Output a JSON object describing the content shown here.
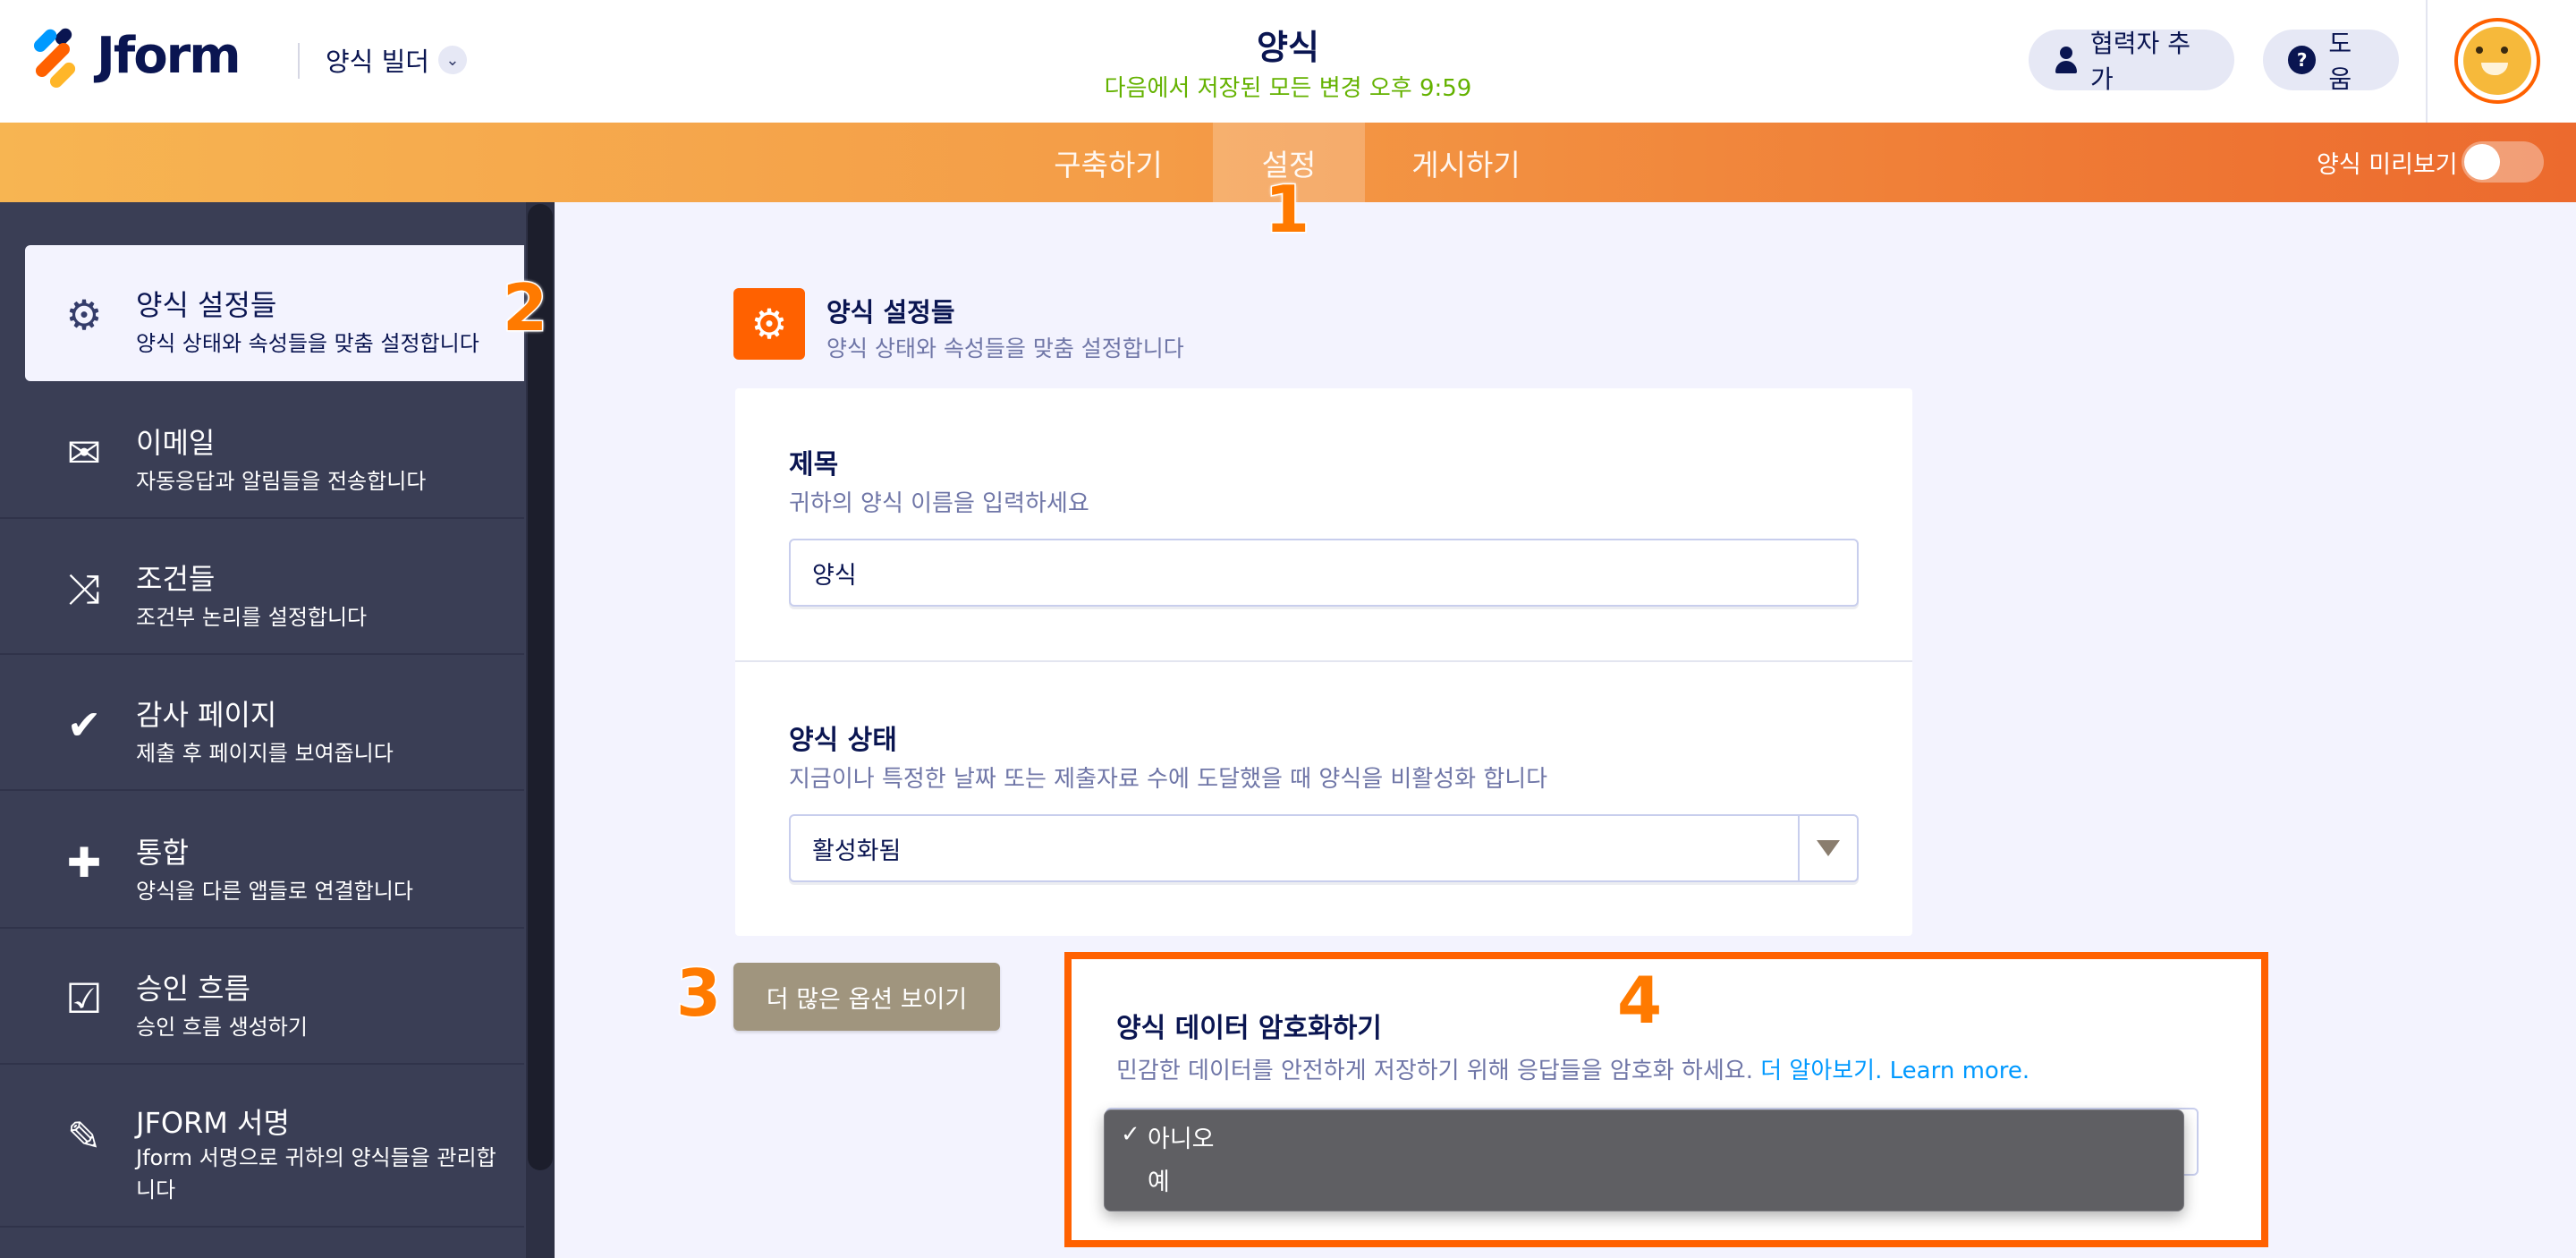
{
  "header": {
    "logo_text": "Jform",
    "builder_label": "양식 빌더",
    "form_title": "양식",
    "save_status": "다음에서 저장된 모든 변경 오후 9:59",
    "add_collaborator_label": "협력자 추가",
    "help_label": "도움"
  },
  "navbar": {
    "tabs": [
      {
        "label": "구축하기"
      },
      {
        "label": "설정"
      },
      {
        "label": "게시하기"
      }
    ],
    "preview_label": "양식 미리보기",
    "preview_enabled": false
  },
  "sidebar": {
    "items": [
      {
        "title": "양식 설정들",
        "desc": "양식 상태와 속성들을 맞춤 설정합니다",
        "icon": "gear-icon",
        "active": true
      },
      {
        "title": "이메일",
        "desc": "자동응답과 알림들을 전송합니다",
        "icon": "envelope-icon"
      },
      {
        "title": "조건들",
        "desc": "조건부 논리를 설정합니다",
        "icon": "shuffle-icon"
      },
      {
        "title": "감사 페이지",
        "desc": "제출 후 페이지를 보여줍니다",
        "icon": "check-circle-icon"
      },
      {
        "title": "통합",
        "desc": "양식을 다른 앱들로 연결합니다",
        "icon": "puzzle-icon"
      },
      {
        "title": "승인 흐름",
        "desc": "승인 흐름 생성하기",
        "icon": "approval-icon"
      },
      {
        "title": "JFORM 서명",
        "desc": "Jform 서명으로 귀하의 양식들을 관리합니다",
        "icon": "pen-icon"
      }
    ]
  },
  "main": {
    "section_title": "양식 설정들",
    "section_desc": "양식 상태와 속성들을 맞춤 설정합니다",
    "title_field": {
      "label": "제목",
      "desc": "귀하의 양식 이름을 입력하세요",
      "value": "양식"
    },
    "status_field": {
      "label": "양식 상태",
      "desc": "지금이나 특정한 날짜 또는 제출자료 수에 도달했을 때 양식을 비활성화 합니다",
      "value": "활성화됨"
    },
    "more_options_label": "더 많은 옵션 보이기",
    "encrypt": {
      "title": "양식 데이터 암호화하기",
      "desc": "민감한 데이터를 안전하게 저장하기 위해 응답들을 암호화 하세요.",
      "link1": "더 알아보기.",
      "link2": "Learn more.",
      "options": [
        "아니오",
        "예"
      ],
      "selected": "아니오"
    }
  },
  "annotations": [
    "1",
    "2",
    "3",
    "4"
  ],
  "colors": {
    "accent": "#ff6100",
    "sidebar_bg": "#3a3e55",
    "link": "#0099ff",
    "save_status": "#64b200"
  }
}
